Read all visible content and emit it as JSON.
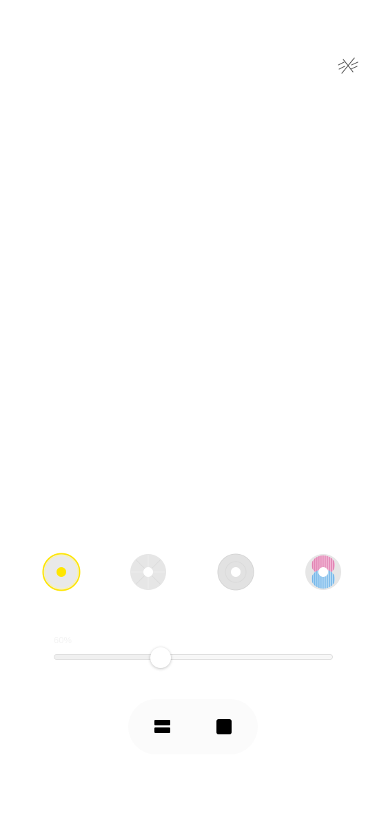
{
  "toolbar": {
    "disconnect_icon": "disconnect-icon"
  },
  "modes": [
    {
      "id": "solid",
      "icon": "solid-dot-icon",
      "selected": true,
      "accent": "#ffe600"
    },
    {
      "id": "petal",
      "icon": "petal-icon",
      "selected": false
    },
    {
      "id": "ring",
      "icon": "ring-icon",
      "selected": false
    },
    {
      "id": "fluid",
      "icon": "fluid-icon",
      "selected": false,
      "colors": [
        "#e86aa7",
        "#6fb3e8"
      ]
    }
  ],
  "slider": {
    "label": "60%",
    "value": 0.38
  },
  "controls": {
    "pause_icon": "pause-icon",
    "stop_icon": "stop-icon"
  },
  "colors": {
    "accent": "#ffe600",
    "neutral": "#e6e6e6"
  }
}
